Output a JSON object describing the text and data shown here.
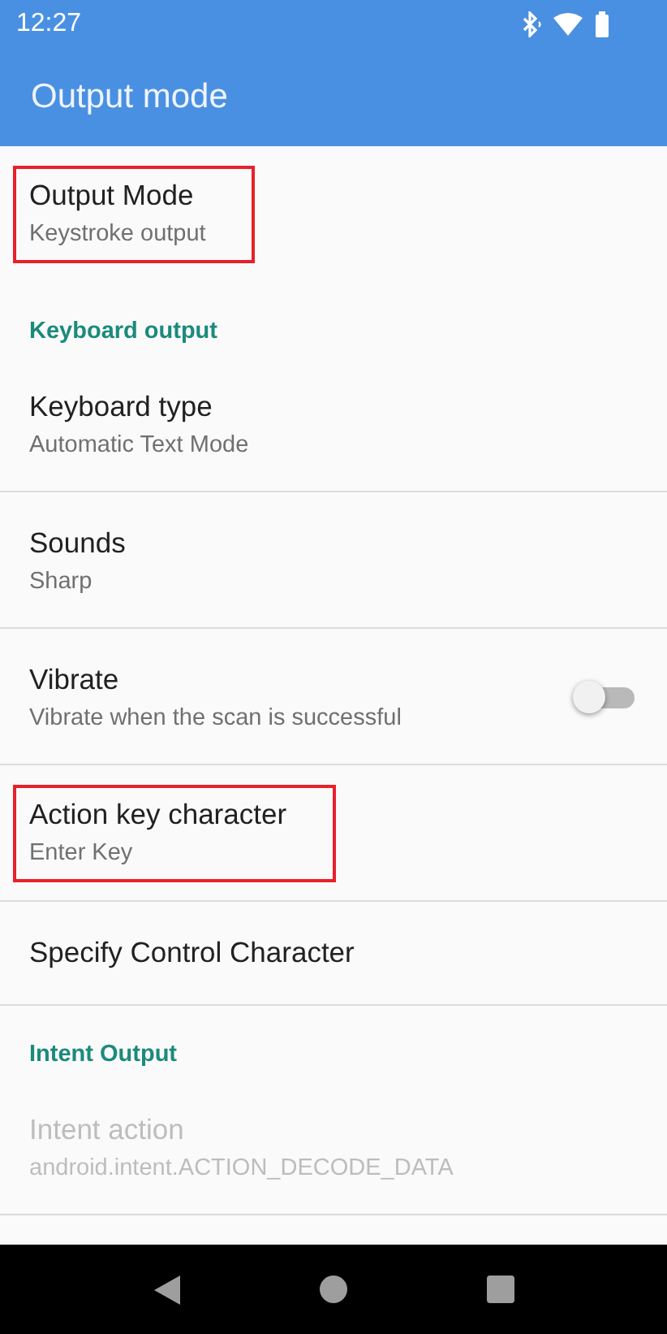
{
  "status_bar": {
    "time": "12:27"
  },
  "app_bar": {
    "title": "Output mode"
  },
  "sections": [
    {
      "items": [
        {
          "kind": "pref",
          "title": "Output Mode",
          "summary": "Keystroke output",
          "disabled": false,
          "highlighted": true
        }
      ]
    },
    {
      "header": "Keyboard output",
      "items": [
        {
          "kind": "pref",
          "title": "Keyboard type",
          "summary": "Automatic Text Mode",
          "disabled": false,
          "highlighted": false
        },
        {
          "kind": "pref",
          "title": "Sounds",
          "summary": "Sharp",
          "disabled": false,
          "highlighted": false
        },
        {
          "kind": "switch",
          "title": "Vibrate",
          "summary": "Vibrate when the scan is successful",
          "disabled": false,
          "highlighted": false,
          "on": false
        },
        {
          "kind": "pref",
          "title": "Action key character",
          "summary": "Enter Key",
          "disabled": false,
          "highlighted": true
        },
        {
          "kind": "pref",
          "title": "Specify Control Character",
          "disabled": false,
          "highlighted": false
        }
      ]
    },
    {
      "header": "Intent Output",
      "items": [
        {
          "kind": "pref",
          "title": "Intent action",
          "summary": "android.intent.ACTION_DECODE_DATA",
          "disabled": true,
          "highlighted": false
        },
        {
          "kind": "cut"
        }
      ]
    }
  ]
}
